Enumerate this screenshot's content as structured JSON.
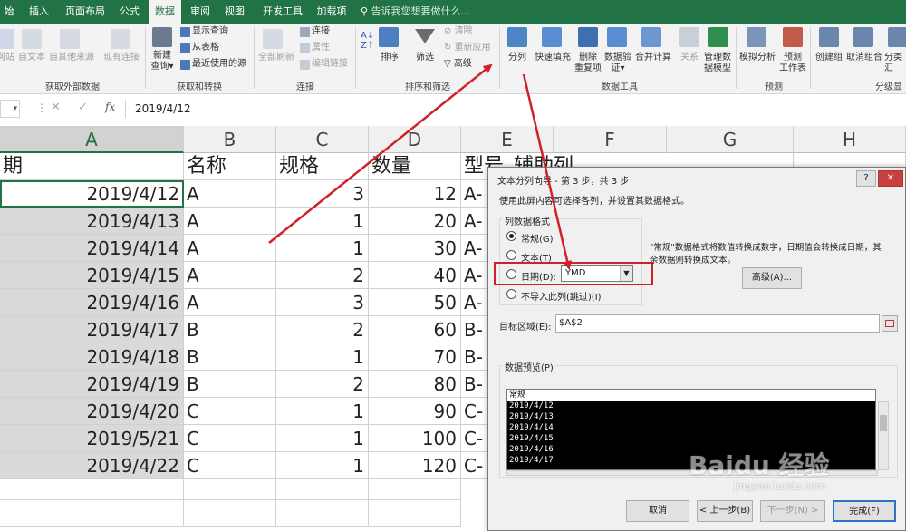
{
  "menu": {
    "tabs": [
      "始",
      "插入",
      "页面布局",
      "公式",
      "数据",
      "审阅",
      "视图",
      "开发工具",
      "加载项"
    ],
    "active": "数据",
    "tellme": "告诉我您想要做什么..."
  },
  "ribbon": {
    "get_external": {
      "items": [
        "网站",
        "自文本",
        "自其他来源",
        "现有连接"
      ],
      "group": "获取外部数据"
    },
    "get_transform": {
      "new_query": "新建",
      "new_query2": "查询",
      "show_query": "显示查询",
      "from_table": "从表格",
      "recent": "最近使用的源",
      "group": "获取和转换"
    },
    "connections": {
      "refresh": "全部刷新",
      "conn": "连接",
      "props": "属性",
      "edit_links": "编辑链接",
      "group": "连接"
    },
    "sort_filter": {
      "sort": "排序",
      "filter": "筛选",
      "clear": "清除",
      "reapply": "重新应用",
      "advanced": "高级",
      "group": "排序和筛选"
    },
    "data_tools": {
      "split": "分列",
      "flash": "快速填充",
      "remove_dup1": "删除",
      "remove_dup2": "重复项",
      "validate1": "数据验",
      "validate2": "证",
      "consolidate": "合并计算",
      "relations": "关系",
      "model1": "管理数",
      "model2": "据模型",
      "group": "数据工具"
    },
    "forecast": {
      "whatif": "模拟分析",
      "sheet1": "预测",
      "sheet2": "工作表",
      "group": "预测"
    },
    "outline": {
      "group_btn": "创建组",
      "ungroup": "取消组合",
      "subtotal": "分类汇",
      "group": "分级显"
    }
  },
  "formula_bar": {
    "value": "2019/4/12",
    "fx": "fx"
  },
  "columns": [
    "A",
    "B",
    "C",
    "D",
    "E",
    "F",
    "G",
    "H"
  ],
  "headers": {
    "A": "期",
    "B": "名称",
    "C": "规格",
    "D": "数量",
    "E": "型号_辅助列"
  },
  "rows": [
    {
      "date": "2019/4/12",
      "name": "A",
      "spec": "3",
      "qty": "12",
      "model": "A-"
    },
    {
      "date": "2019/4/13",
      "name": "A",
      "spec": "1",
      "qty": "20",
      "model": "A-"
    },
    {
      "date": "2019/4/14",
      "name": "A",
      "spec": "1",
      "qty": "30",
      "model": "A-"
    },
    {
      "date": "2019/4/15",
      "name": "A",
      "spec": "2",
      "qty": "40",
      "model": "A-"
    },
    {
      "date": "2019/4/16",
      "name": "A",
      "spec": "3",
      "qty": "50",
      "model": "A-"
    },
    {
      "date": "2019/4/17",
      "name": "B",
      "spec": "2",
      "qty": "60",
      "model": "B-"
    },
    {
      "date": "2019/4/18",
      "name": "B",
      "spec": "1",
      "qty": "70",
      "model": "B-"
    },
    {
      "date": "2019/4/19",
      "name": "B",
      "spec": "2",
      "qty": "80",
      "model": "B-"
    },
    {
      "date": "2019/4/20",
      "name": "C",
      "spec": "1",
      "qty": "90",
      "model": "C-"
    },
    {
      "date": "2019/5/21",
      "name": "C",
      "spec": "1",
      "qty": "100",
      "model": "C-"
    },
    {
      "date": "2019/4/22",
      "name": "C",
      "spec": "1",
      "qty": "120",
      "model": "C-"
    }
  ],
  "dialog": {
    "title": "文本分列向导 - 第 3 步，共 3 步",
    "help": "?",
    "close": "✕",
    "intro": "使用此屏内容可选择各列，并设置其数据格式。",
    "fmt_label": "列数据格式",
    "opt_general": "常规(G)",
    "opt_text": "文本(T)",
    "opt_date": "日期(D):",
    "date_value": "YMD",
    "opt_skip": "不导入此列(跳过)(I)",
    "desc1": "\"常规\"数据格式将数值转换成数字，日期值会转换成日期，其",
    "desc2": "余数据则转换成文本。",
    "advanced": "高级(A)...",
    "dest_label": "目标区域(E):",
    "dest_value": "$A$2",
    "preview_label": "数据预览(P)",
    "preview_header": "常规",
    "preview_rows": [
      "2019/4/12",
      "2019/4/13",
      "2019/4/14",
      "2019/4/15",
      "2019/4/16",
      "2019/4/17"
    ],
    "cancel": "取消",
    "back": "< 上一步(B)",
    "next": "下一步(N) >",
    "finish": "完成(F)"
  },
  "watermark": {
    "logo": "Baidu 经验",
    "url": "jingyan.baidu.com"
  },
  "colors": {
    "excel_green": "#217346",
    "annotation_red": "#d0202a"
  }
}
